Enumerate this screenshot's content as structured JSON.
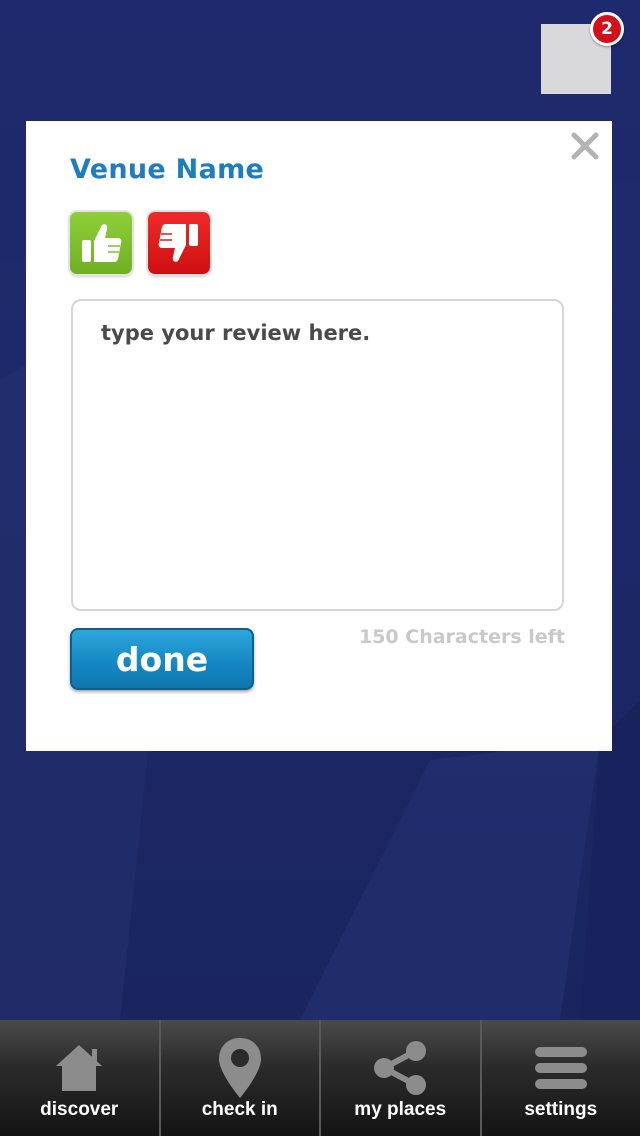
{
  "notification": {
    "count": "2"
  },
  "modal": {
    "venue_name": "Venue Name",
    "review_placeholder": "type your review here.",
    "review_value": "",
    "chars_left": "150 Characters left",
    "done_label": "done"
  },
  "tabbar": {
    "items": [
      {
        "label": "discover",
        "icon": "home-icon"
      },
      {
        "label": "check in",
        "icon": "location-pin-icon"
      },
      {
        "label": "my places",
        "icon": "share-icon"
      },
      {
        "label": "settings",
        "icon": "menu-icon"
      }
    ]
  },
  "colors": {
    "background": "#1b2766",
    "accent_blue": "#1f7cc0",
    "thumbs_up_green": "#7cc12c",
    "thumbs_down_red": "#e11b1b",
    "badge_red": "#d4101c",
    "button_blue": "#1a93cf"
  }
}
